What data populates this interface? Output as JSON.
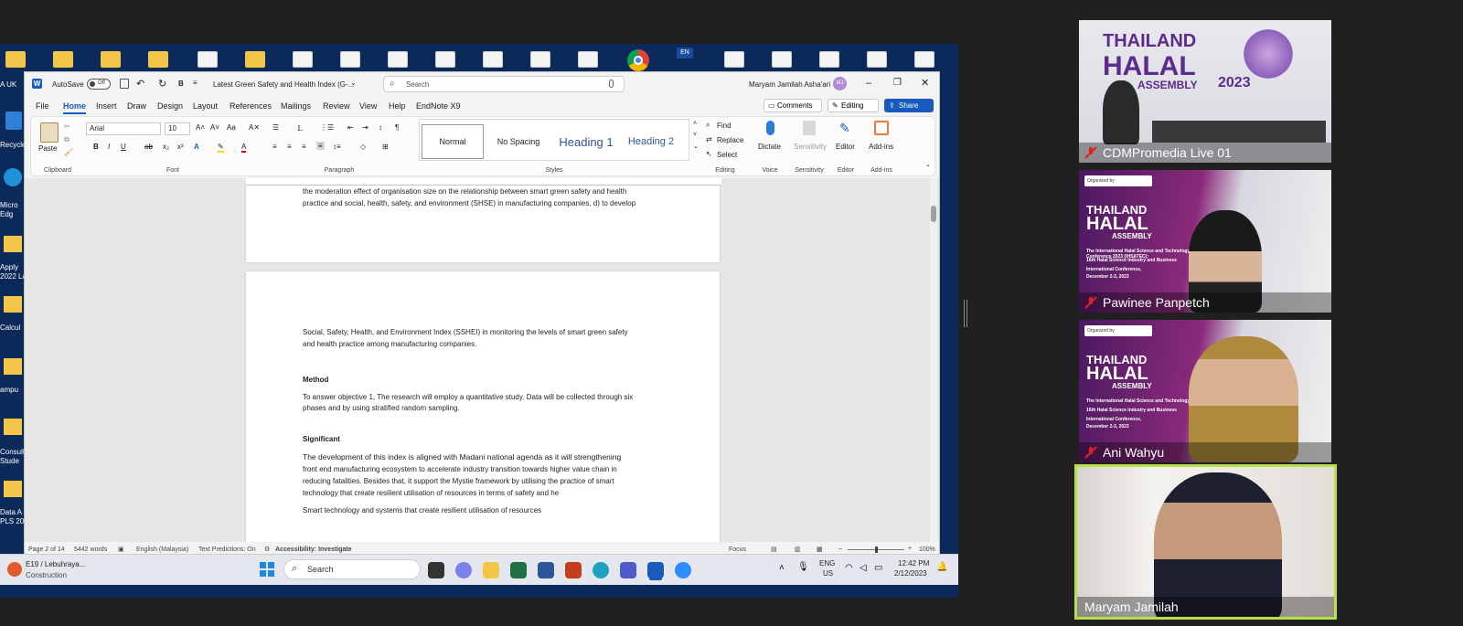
{
  "desktop": {
    "left_labels": [
      "A UK",
      "Recycle",
      "Micro Edg",
      "Apply 2022 La",
      "Calcul",
      "ampu",
      "Consult Stude",
      "Data A PLS 20"
    ],
    "lang_indicator": "EN"
  },
  "word": {
    "autosave_label": "AutoSave",
    "autosave_state": "Off",
    "doc_title": "Latest Green Safety and Health Index (G-...",
    "search_placeholder": "Search",
    "user_name": "Maryam Jamilah Asha'ari",
    "user_initials": "MJ",
    "menu": [
      "File",
      "Home",
      "Insert",
      "Draw",
      "Design",
      "Layout",
      "References",
      "Mailings",
      "Review",
      "View",
      "Help",
      "EndNote X9"
    ],
    "comments_label": "Comments",
    "editing_label": "Editing",
    "share_label": "Share",
    "ribbon": {
      "paste_label": "Paste",
      "clipboard_label": "Clipboard",
      "font_name": "Arial",
      "font_size": "10",
      "font_label": "Font",
      "paragraph_label": "Paragraph",
      "styles_label": "Styles",
      "styles": [
        "Normal",
        "No Spacing",
        "Heading 1",
        "Heading 2"
      ],
      "find_label": "Find",
      "replace_label": "Replace",
      "select_label": "Select",
      "editing_group_label": "Editing",
      "dictate_label": "Dictate",
      "voice_label": "Voice",
      "sensitivity_label": "Sensitivity",
      "editor_label": "Editor",
      "addins_label": "Add-ins"
    },
    "document": {
      "page1_line1": "the moderation effect of organisation size on the relationship between smart green safety and health",
      "page1_line2": "practice and social, health, safety, and environment (SHSE) in manufacturing companies, d) to develop",
      "p_intro_1": "Social, Safety, Health, and Environment Index (SSHEI) in monitoring the levels of smart green safety",
      "p_intro_2": "and health practice among manufacturing companies.",
      "method_heading": "Method",
      "method_1": "To answer objective 1, The research will employ a quantitative study. Data will be collected through six",
      "method_2": "phases and by using stratified random sampling.",
      "significant_heading": "Significant",
      "sig_1": "The development of this index is aligned with Madani national agenda as it will strengthening",
      "sig_2": "front end manufacturing ecosystem to accelerate industry transition towards higher value chain in",
      "sig_3": "reducing fatalities. Besides that, it support the Mystie framework by utilising the practice of smart",
      "sig_4": "technology that create resilient utilisation of resources in terms of safety and he",
      "sig_5": "Smart technology and systems that create resilient utilisation of resources"
    },
    "status": {
      "page": "Page 2 of 14",
      "words": "5442 words",
      "language": "English (Malaysia)",
      "predictions": "Text Predictions: On",
      "accessibility": "Accessibility: Investigate",
      "focus": "Focus",
      "zoom": "100%"
    }
  },
  "taskbar": {
    "weather_title": "E19 / Lebuhraya...",
    "weather_sub": "Construction",
    "search_placeholder": "Search",
    "lang_top": "ENG",
    "lang_bottom": "US",
    "time": "12:42 PM",
    "date": "2/12/2023"
  },
  "participants": [
    {
      "name": "CDMPromedia Live 01",
      "muted": true
    },
    {
      "name": "Pawinee Panpetch",
      "muted": true
    },
    {
      "name": "Ani Wahyu",
      "muted": true
    },
    {
      "name": "Maryam Jamilah",
      "muted": false
    }
  ],
  "banner": {
    "line1": "THAILAND",
    "line2": "HALAL",
    "line3": "ASSEMBLY",
    "year": "2023",
    "conf_line1": "The International Halal Science and Technology Conference 2023 (IHSATEC):",
    "conf_line2": "16th Halal Science Industry and Business",
    "conf_line3": "International Conference,",
    "conf_dates": "December 2-3, 2023",
    "organized": "Organized by"
  },
  "colors": {
    "word_blue": "#185abd",
    "active_speaker": "#b8e04a",
    "banner_purple": "#6b1f73",
    "banner_magenta": "#c03c8c"
  }
}
